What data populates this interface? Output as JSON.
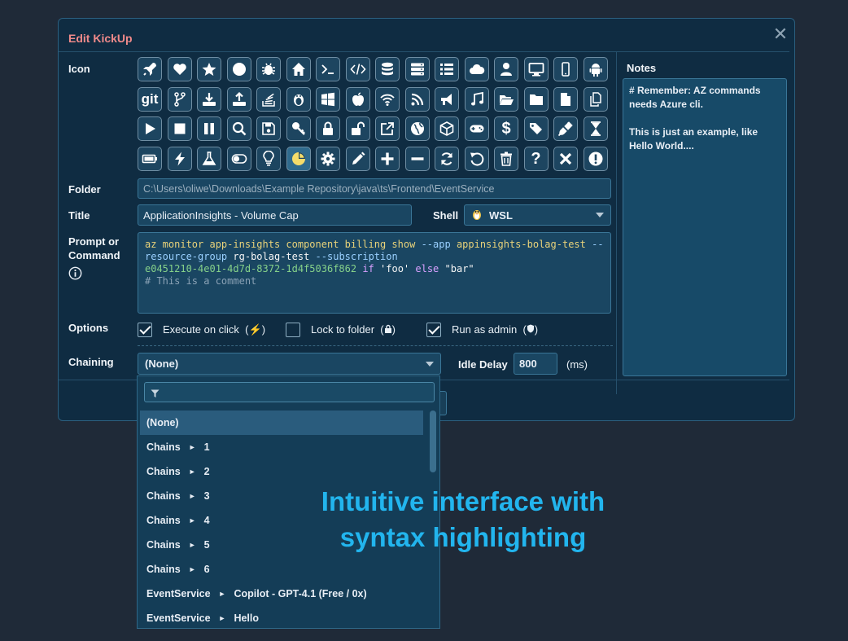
{
  "dialog": {
    "title": "Edit KickUp",
    "close": "✕"
  },
  "labels": {
    "icon": "Icon",
    "folder": "Folder",
    "title": "Title",
    "shell": "Shell",
    "prompt_line1": "Prompt or",
    "prompt_line2": "Command",
    "options": "Options",
    "chaining": "Chaining",
    "idle_delay": "Idle Delay",
    "ms": "(ms)",
    "notes": "Notes"
  },
  "fields": {
    "folder": "C:\\Users\\oliwe\\Downloads\\Example Repository\\java\\ts\\Frontend\\EventService",
    "title": "ApplicationInsights - Volume Cap",
    "shell": "WSL",
    "chaining": "(None)",
    "idle_delay": "800"
  },
  "code": {
    "cmd": "az monitor app-insights component billing show",
    "app_flag": "--app",
    "app_val": "appinsights-bolag-test",
    "rg_flag": "--resource-group",
    "rg_val": "rg-bolag-test",
    "sub_flag": "--subscription",
    "sub_val": "e0451210-4e01-4d7d-8372-1d4f5036f862",
    "if_kw": "if",
    "foo": "'foo'",
    "else_kw": "else",
    "bar": "\"bar\"",
    "comment": "# This is a comment"
  },
  "options": {
    "execute": {
      "label": "Execute on click",
      "glyph": "⚡",
      "checked": true
    },
    "lock": {
      "label": "Lock to folder",
      "glyph": "🔒",
      "checked": false
    },
    "admin": {
      "label": "Run as admin",
      "glyph": "🛡",
      "checked": true
    }
  },
  "notes": "# Remember: AZ commands needs Azure cli.\n\nThis is just an example, like Hello World....",
  "dropdown": {
    "items": [
      {
        "a": "(None)",
        "b": ""
      },
      {
        "a": "Chains",
        "b": "1"
      },
      {
        "a": "Chains",
        "b": "2"
      },
      {
        "a": "Chains",
        "b": "3"
      },
      {
        "a": "Chains",
        "b": "4"
      },
      {
        "a": "Chains",
        "b": "5"
      },
      {
        "a": "Chains",
        "b": "6"
      },
      {
        "a": "EventService",
        "b": "Copilot - GPT-4.1 (Free / 0x)"
      },
      {
        "a": "EventService",
        "b": "Hello"
      }
    ],
    "arrow": "►"
  },
  "overlay": {
    "line1": "Intuitive interface with",
    "line2": "syntax highlighting"
  },
  "icons": [
    [
      "rocket-icon",
      "heart-icon",
      "star-icon",
      "circle-icon",
      "bug-icon",
      "home-icon",
      "terminal-icon",
      "code-icon",
      "database-icon",
      "server-icon",
      "list-icon",
      "cloud-icon",
      "user-icon",
      "desktop-icon",
      "mobile-icon",
      "android-icon"
    ],
    [
      "git-icon",
      "branch-icon",
      "download-icon",
      "upload-icon",
      "stack-icon",
      "linux-icon",
      "windows-icon",
      "apple-icon",
      "wifi-icon",
      "rss-icon",
      "megaphone-icon",
      "music-icon",
      "folder-open-icon",
      "folder-icon",
      "file-icon",
      "copy-icon"
    ],
    [
      "play-icon",
      "stop-icon",
      "pause-icon",
      "search-icon",
      "save-icon",
      "key-icon",
      "lock-icon",
      "unlock-icon",
      "external-link-icon",
      "globe-icon",
      "cube-icon",
      "gamepad-icon",
      "dollar-icon",
      "tags-icon",
      "plug-icon",
      "hourglass-icon"
    ],
    [
      "battery-icon",
      "bolt-icon",
      "flask-icon",
      "toggle-icon",
      "lightbulb-icon",
      "pie-chart-icon",
      "gear-icon",
      "pencil-icon",
      "plus-icon",
      "minus-icon",
      "refresh-icon",
      "undo-icon",
      "trash-icon",
      "question-icon",
      "times-icon",
      "exclamation-icon"
    ]
  ],
  "icon_text": {
    "git": "git",
    "question": "?",
    "dollar": "$",
    "terminal": ">_",
    "code": "</>"
  },
  "selected_icon": "pie-chart-icon"
}
